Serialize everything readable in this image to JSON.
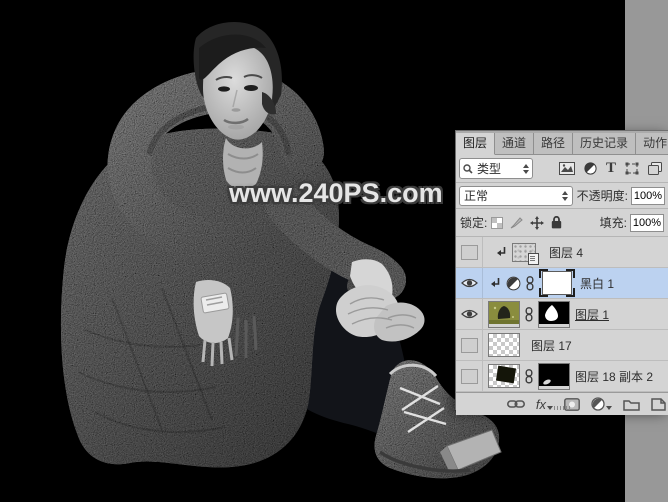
{
  "image": {
    "watermark": "www.240PS.com"
  },
  "layers_panel": {
    "tabs": [
      {
        "label": "图层",
        "active": true
      },
      {
        "label": "通道",
        "active": false
      },
      {
        "label": "路径",
        "active": false
      },
      {
        "label": "历史记录",
        "active": false
      },
      {
        "label": "动作",
        "active": false
      }
    ],
    "filter_bar": {
      "search_type_label": "类型",
      "type_tool_glyph": "T"
    },
    "blend_bar": {
      "blend_mode": "正常",
      "opacity_label": "不透明度:",
      "opacity_value": "100%"
    },
    "lock_bar": {
      "lock_label": "锁定:",
      "fill_label": "填充:",
      "fill_value": "100%"
    },
    "layers": [
      {
        "name": "图层 4",
        "visible": false,
        "clipped": true,
        "selected": false
      },
      {
        "name": "黑白 1",
        "visible": true,
        "clipped": true,
        "selected": true
      },
      {
        "name": "图层 1",
        "visible": true,
        "clipped": false,
        "selected": false
      },
      {
        "name": "图层 17",
        "visible": false,
        "clipped": false,
        "selected": false
      },
      {
        "name": "图层 18 副本 2",
        "visible": false,
        "clipped": false,
        "selected": false
      }
    ],
    "bottom_bar": {
      "fx_label": "fx"
    }
  },
  "colors": {
    "selected_row": "#bcd2f0",
    "panel_background": "#d4d4d4",
    "dock_strip": "#989898",
    "canvas_background": "#000000",
    "layer1_thumbnail_olive": "#8a8d3e"
  }
}
